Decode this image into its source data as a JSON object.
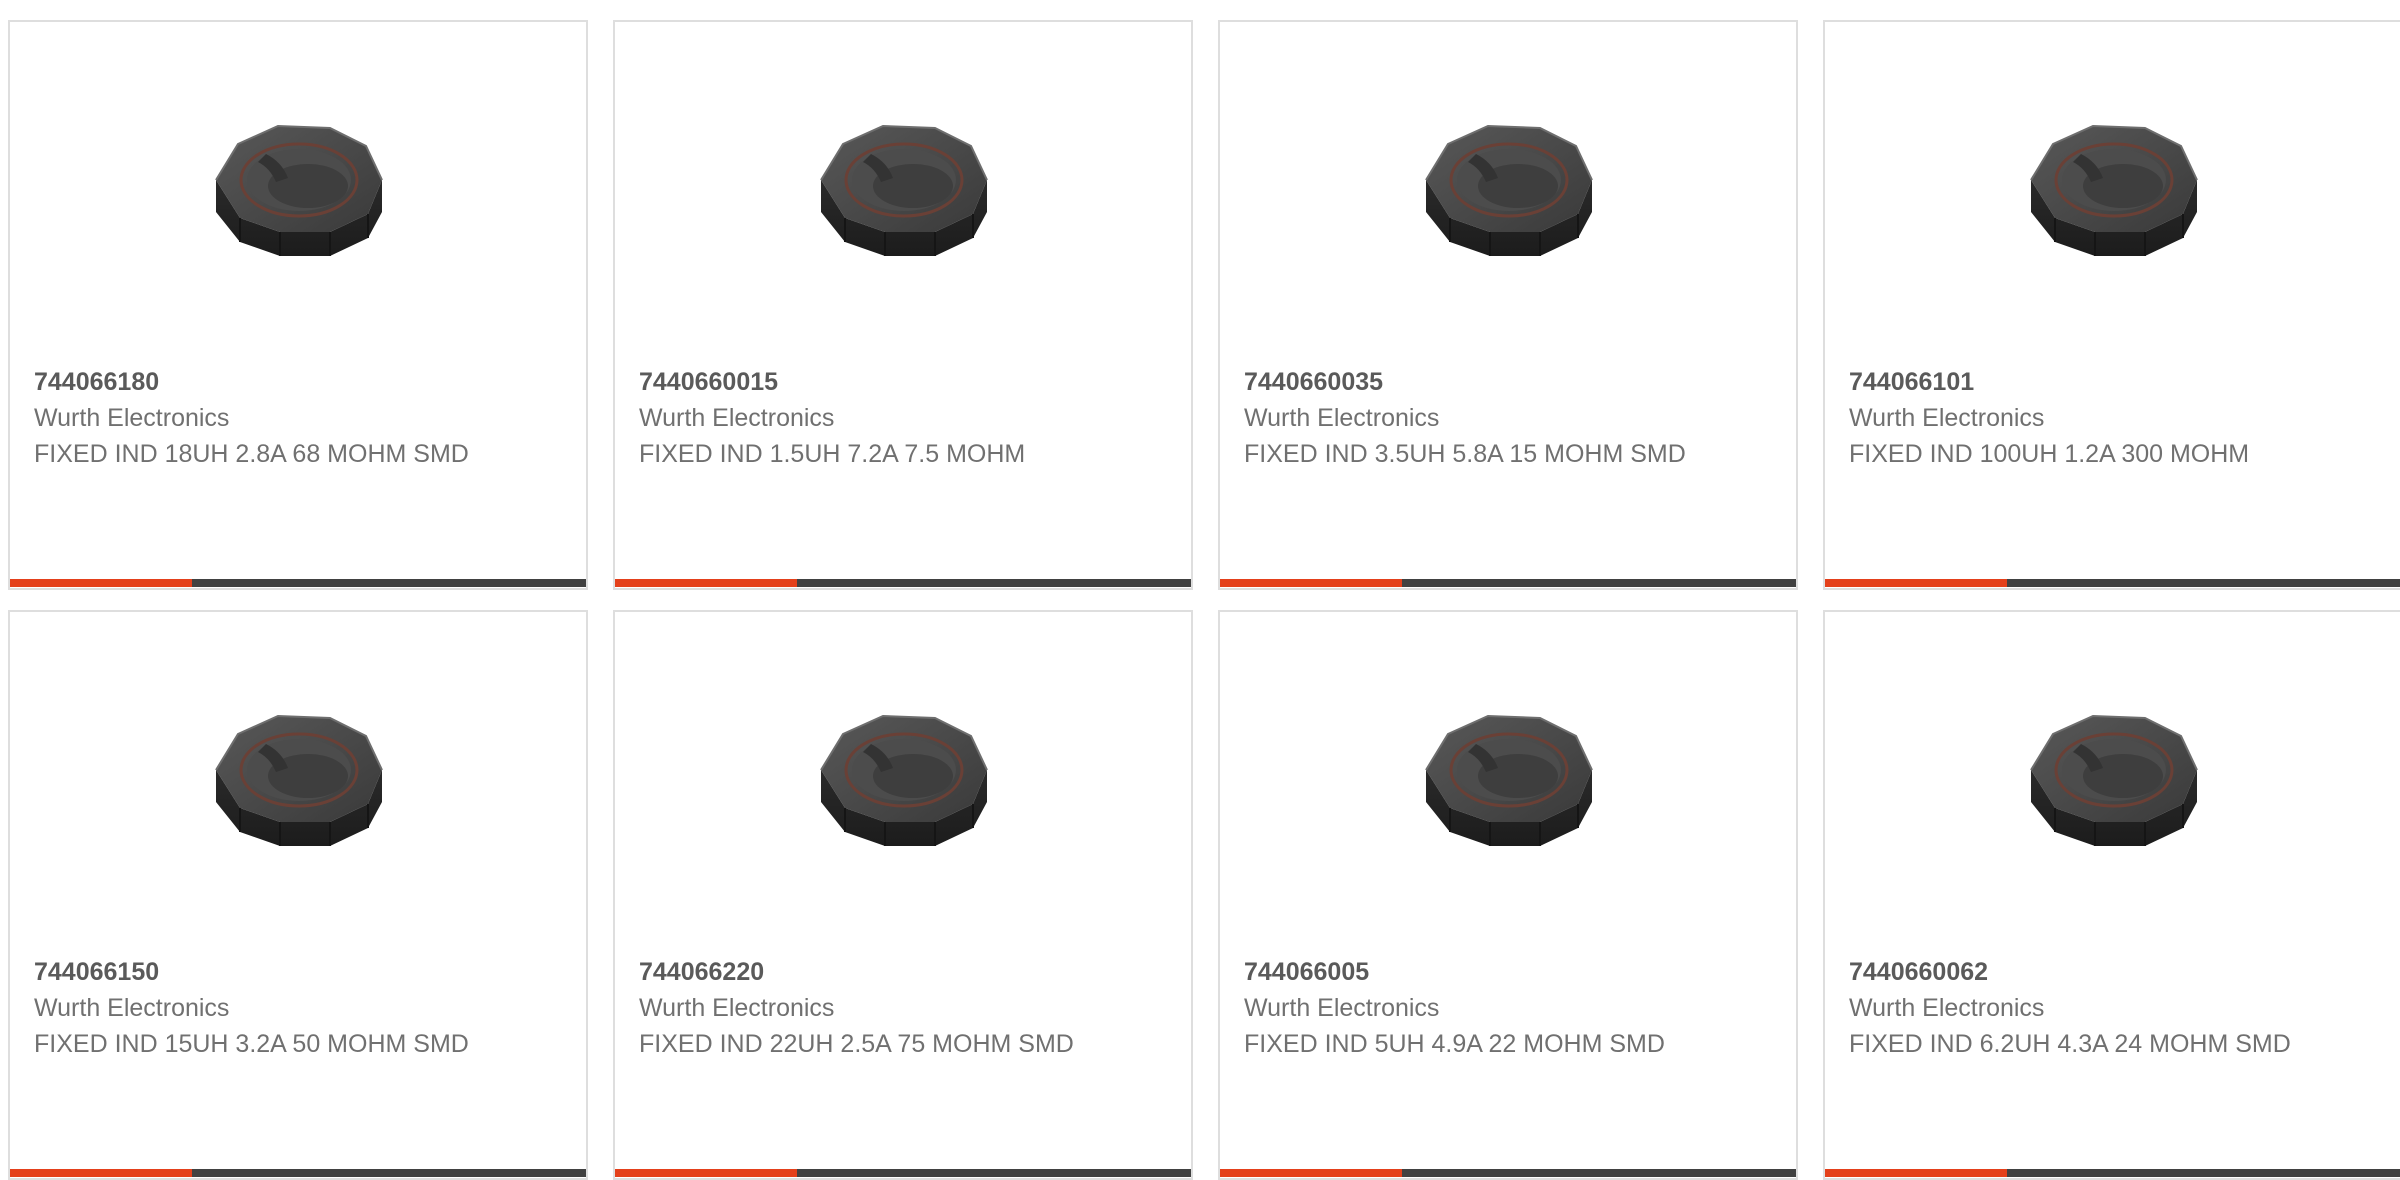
{
  "colors": {
    "accent": "#e4401b",
    "bar": "#414141",
    "border": "#dedede",
    "part_number_text": "#5a5a5a",
    "body_text": "#707070"
  },
  "products": [
    {
      "part_number": "744066180",
      "manufacturer": "Wurth Electronics",
      "description": "FIXED IND 18UH 2.8A 68 MOHM SMD",
      "image_icon": "smd-inductor-image"
    },
    {
      "part_number": "7440660015",
      "manufacturer": "Wurth Electronics",
      "description": "FIXED IND 1.5UH 7.2A 7.5 MOHM",
      "image_icon": "smd-inductor-image"
    },
    {
      "part_number": "7440660035",
      "manufacturer": "Wurth Electronics",
      "description": "FIXED IND 3.5UH 5.8A 15 MOHM SMD",
      "image_icon": "smd-inductor-image"
    },
    {
      "part_number": "744066101",
      "manufacturer": "Wurth Electronics",
      "description": "FIXED IND 100UH 1.2A 300 MOHM",
      "image_icon": "smd-inductor-image"
    },
    {
      "part_number": "744066150",
      "manufacturer": "Wurth Electronics",
      "description": "FIXED IND 15UH 3.2A 50 MOHM SMD",
      "image_icon": "smd-inductor-image"
    },
    {
      "part_number": "744066220",
      "manufacturer": "Wurth Electronics",
      "description": "FIXED IND 22UH 2.5A 75 MOHM SMD",
      "image_icon": "smd-inductor-image"
    },
    {
      "part_number": "744066005",
      "manufacturer": "Wurth Electronics",
      "description": "FIXED IND 5UH 4.9A 22 MOHM SMD",
      "image_icon": "smd-inductor-image"
    },
    {
      "part_number": "7440660062",
      "manufacturer": "Wurth Electronics",
      "description": "FIXED IND 6.2UH 4.3A 24 MOHM SMD",
      "image_icon": "smd-inductor-image"
    }
  ]
}
